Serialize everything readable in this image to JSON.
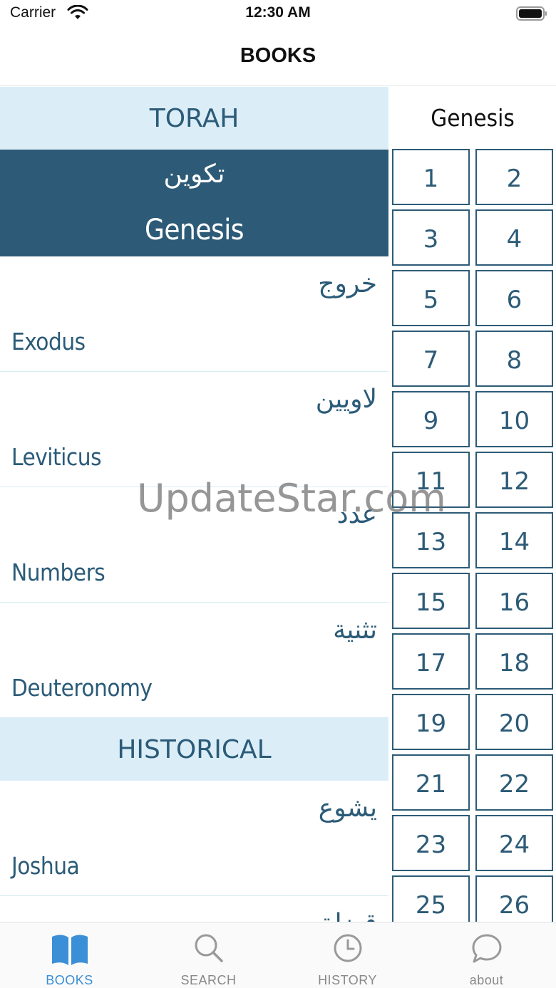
{
  "status_bar": {
    "carrier": "Carrier",
    "time": "12:30 AM"
  },
  "navbar": {
    "title": "BOOKS"
  },
  "books": {
    "sections": [
      {
        "header": "TORAH",
        "items": [
          {
            "arabic": "تكوين",
            "english": "Genesis",
            "selected": true
          },
          {
            "arabic": "خروج",
            "english": "Exodus"
          },
          {
            "arabic": "لاويين",
            "english": "Leviticus"
          },
          {
            "arabic": "عدد",
            "english": "Numbers"
          },
          {
            "arabic": "تثنية",
            "english": "Deuteronomy"
          }
        ]
      },
      {
        "header": "HISTORICAL",
        "items": [
          {
            "arabic": "يشوع",
            "english": "Joshua"
          },
          {
            "arabic": "قضاة",
            "english": ""
          }
        ]
      }
    ]
  },
  "chapters": {
    "title": "Genesis",
    "numbers": [
      "1",
      "2",
      "3",
      "4",
      "5",
      "6",
      "7",
      "8",
      "9",
      "10",
      "11",
      "12",
      "13",
      "14",
      "15",
      "16",
      "17",
      "18",
      "19",
      "20",
      "21",
      "22",
      "23",
      "24",
      "25",
      "26"
    ]
  },
  "watermark": "UpdateStar.com",
  "tabbar": {
    "tabs": [
      {
        "label": "BOOKS",
        "icon": "book-icon",
        "active": true
      },
      {
        "label": "SEARCH",
        "icon": "search-icon"
      },
      {
        "label": "HISTORY",
        "icon": "clock-icon"
      },
      {
        "label": "about",
        "icon": "chat-bubble-icon"
      }
    ]
  },
  "colors": {
    "accent": "#2d5b77",
    "section_bg": "#dbeef8",
    "tab_active": "#3b8fd6",
    "tab_inactive": "#888888"
  }
}
